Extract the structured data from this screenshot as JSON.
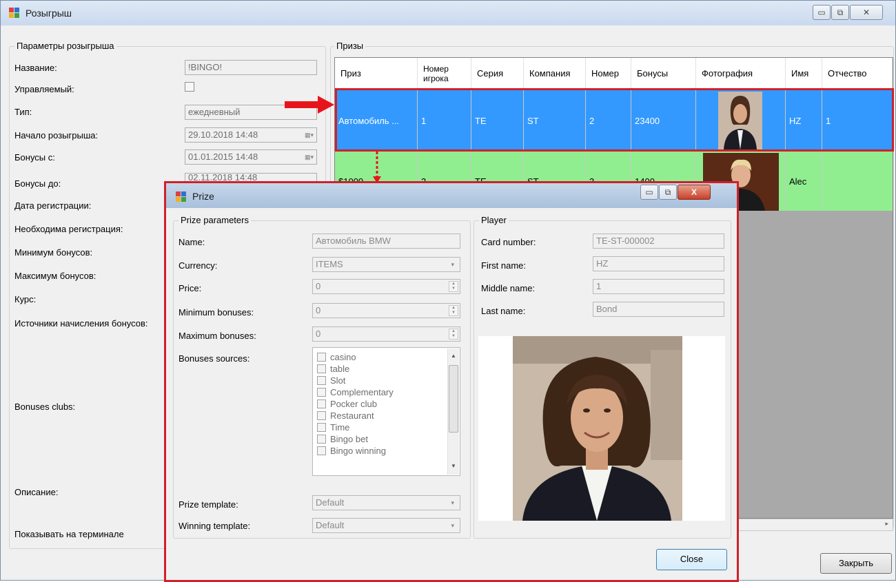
{
  "main_window": {
    "title": "Розыгрыш",
    "caption_buttons": {
      "minimize": "▭",
      "restore": "⧉",
      "close": "✕"
    },
    "params_group_title": "Параметры розыгрыша",
    "labels": {
      "name": "Название:",
      "managed": "Управляемый:",
      "type": "Тип:",
      "start": "Начало розыгрыша:",
      "bonuses_from": "Бонусы с:",
      "bonuses_to": "Бонусы до:",
      "registration_date": "Дата регистрации:",
      "registration_required": "Необходима регистрация:",
      "min_bonuses": "Минимум бонусов:",
      "max_bonuses": "Максимум бонусов:",
      "rate": "Курс:",
      "bonus_sources": "Источники начисления бонусов:",
      "bonus_clubs": "Bonuses clubs:",
      "description": "Описание:",
      "show_on_terminal": "Показывать на терминале"
    },
    "values": {
      "name": "!BINGO!",
      "type": "ежедневный",
      "start": "29.10.2018 14:48",
      "bonuses_from": "01.01.2015 14:48",
      "bonuses_to": "02.11.2018 14:48"
    },
    "prizes_group_title": "Призы",
    "close_button": "Закрыть"
  },
  "prizes_table": {
    "columns": [
      "Приз",
      "Номер игрока",
      "Серия",
      "Компания",
      "Номер",
      "Бонусы",
      "Фотография",
      "Имя",
      "Отчество"
    ],
    "rows": [
      {
        "prize": "Автомобиль ...",
        "player": "1",
        "series": "TE",
        "company": "ST",
        "number": "2",
        "bonuses": "23400",
        "name": "HZ",
        "patronymic": "1"
      },
      {
        "prize": "$1000",
        "player": "2",
        "series": "TE",
        "company": "ST",
        "number": "3",
        "bonuses": "1400",
        "name": "Alec",
        "patronymic": ""
      }
    ]
  },
  "prize_dialog": {
    "title": "Prize",
    "caption_buttons": {
      "minimize": "▭",
      "restore": "⧉",
      "close": "X"
    },
    "params_group_title": "Prize parameters",
    "labels": {
      "name": "Name:",
      "currency": "Currency:",
      "price": "Price:",
      "min_bonuses": "Minimum bonuses:",
      "max_bonuses": "Maximum bonuses:",
      "bonus_sources": "Bonuses sources:",
      "prize_template": "Prize template:",
      "winning_template": "Winning template:"
    },
    "values": {
      "name": "Автомобиль BMW",
      "currency": "ITEMS",
      "price": "0",
      "min_bonuses": "0",
      "max_bonuses": "0",
      "prize_template": "Default",
      "winning_template": "Default"
    },
    "bonus_sources": [
      "casino",
      "table",
      "Slot",
      "Complementary",
      "Pocker club",
      "Restaurant",
      "Time",
      "Bingo bet",
      "Bingo winning"
    ],
    "player_group_title": "Player",
    "player_labels": {
      "card": "Card number:",
      "first": "First name:",
      "middle": "Middle name:",
      "last": "Last name:"
    },
    "player_values": {
      "card": "TE-ST-000002",
      "first": "HZ",
      "middle": "1",
      "last": "Bond"
    },
    "close_button": "Close"
  },
  "colors": {
    "selected_row": "#3399ff",
    "second_row": "#90ee90",
    "highlight": "#d0202a",
    "dialog_title": "#a9c0dc"
  }
}
